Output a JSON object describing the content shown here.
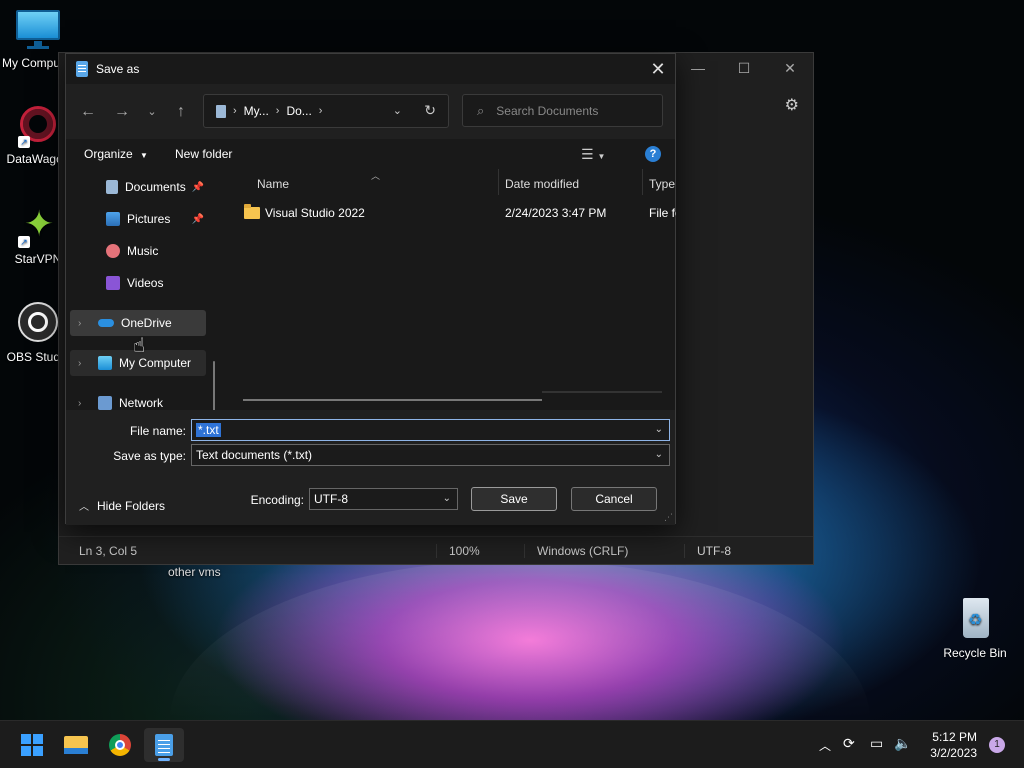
{
  "desktop": {
    "icons": [
      {
        "label": "My Computer",
        "icon": "monitor-icon"
      },
      {
        "label": "DataWagon",
        "icon": "datawagon-icon"
      },
      {
        "label": "StarVPN",
        "icon": "starvpn-icon"
      },
      {
        "label": "OBS Studio",
        "icon": "obs-icon"
      },
      {
        "label": "Recycle Bin",
        "icon": "recycle-bin-icon"
      }
    ],
    "folder_label": "other vms"
  },
  "notepad": {
    "status": {
      "position": "Ln 3, Col 5",
      "zoom": "100%",
      "line_ending": "Windows (CRLF)",
      "encoding": "UTF-8"
    }
  },
  "dialog": {
    "title": "Save as",
    "address": {
      "crumbs": [
        "My...",
        "Do..."
      ]
    },
    "search": {
      "placeholder": "Search Documents"
    },
    "toolbar": {
      "organize": "Organize",
      "new_folder": "New folder"
    },
    "sidebar": {
      "items": [
        {
          "label": "Documents",
          "icon": "documents-icon",
          "pinned": true
        },
        {
          "label": "Pictures",
          "icon": "pictures-icon",
          "pinned": true
        },
        {
          "label": "Music",
          "icon": "music-icon"
        },
        {
          "label": "Videos",
          "icon": "videos-icon"
        },
        {
          "label": "OneDrive",
          "icon": "onedrive-icon"
        },
        {
          "label": "My Computer",
          "icon": "monitor-icon"
        },
        {
          "label": "Network",
          "icon": "network-icon"
        }
      ]
    },
    "columns": [
      "Name",
      "Date modified",
      "Type"
    ],
    "files": [
      {
        "name": "Visual Studio 2022",
        "modified": "2/24/2023 3:47 PM",
        "type": "File fo"
      }
    ],
    "file_name_label": "File name:",
    "file_name_value": "*.txt",
    "save_type_label": "Save as type:",
    "save_type_value": "Text documents (*.txt)",
    "encoding_label": "Encoding:",
    "encoding_value": "UTF-8",
    "save_label": "Save",
    "cancel_label": "Cancel",
    "hide_folders_label": "Hide Folders"
  },
  "taskbar": {
    "clock_time": "5:12 PM",
    "clock_date": "3/2/2023",
    "notification_count": "1"
  },
  "colors": {
    "accent": "#2f73d6",
    "dialog_bg": "#191919"
  }
}
